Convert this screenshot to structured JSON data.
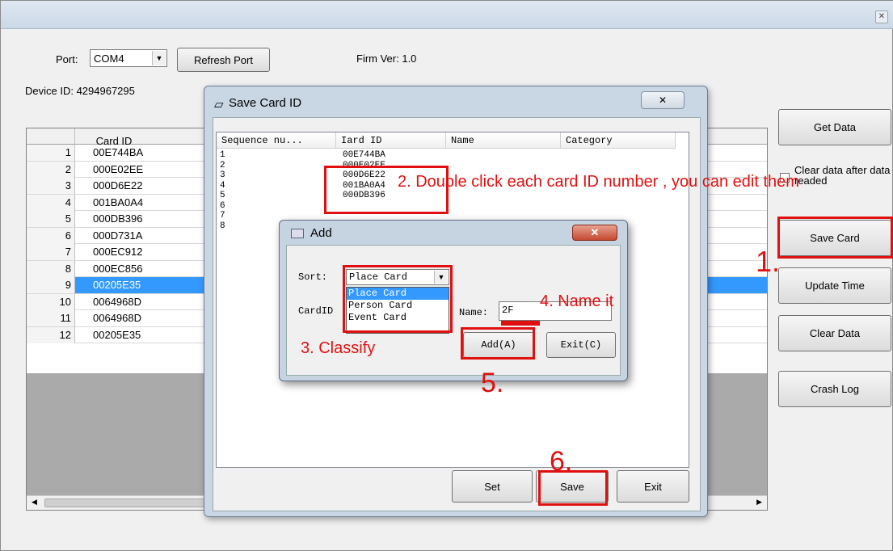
{
  "main": {
    "port_label": "Port:",
    "port_value": "COM4",
    "refresh_port": "Refresh Port",
    "firm_ver": "Firm Ver: 1.0",
    "device_id": "Device ID: 4294967295",
    "grid_header": "Card ID",
    "rows": [
      {
        "n": "1",
        "id": "00E744BA"
      },
      {
        "n": "2",
        "id": "000E02EE"
      },
      {
        "n": "3",
        "id": "000D6E22"
      },
      {
        "n": "4",
        "id": "001BA0A4"
      },
      {
        "n": "5",
        "id": "000DB396"
      },
      {
        "n": "6",
        "id": "000D731A"
      },
      {
        "n": "7",
        "id": "000EC912"
      },
      {
        "n": "8",
        "id": "000EC856"
      },
      {
        "n": "9",
        "id": "00205E35"
      },
      {
        "n": "10",
        "id": "0064968D"
      },
      {
        "n": "11",
        "id": "0064968D"
      },
      {
        "n": "12",
        "id": "00205E35"
      }
    ],
    "selected_row": "9"
  },
  "right_panel": {
    "get_data": "Get Data",
    "clear_after": "Clear data after data readed",
    "save_card": "Save Card",
    "update_time": "Update Time",
    "clear_data": "Clear Data",
    "crash_log": "Crash Log"
  },
  "save_dialog": {
    "title": "Save Card ID",
    "close": "✕",
    "columns": [
      "Sequence nu...",
      "Iard ID",
      "Name",
      "Category"
    ],
    "rows": [
      {
        "seq": "1",
        "id": "00E744BA"
      },
      {
        "seq": "2",
        "id": "000E02EE"
      },
      {
        "seq": "3",
        "id": "000D6E22"
      },
      {
        "seq": "4",
        "id": "001BA0A4"
      },
      {
        "seq": "5",
        "id": "000DB396"
      },
      {
        "seq": "6",
        "id": ""
      },
      {
        "seq": "7",
        "id": ""
      },
      {
        "seq": "8",
        "id": ""
      }
    ],
    "set_button": "Set",
    "save_button": "Save",
    "exit_button": "Exit"
  },
  "add_dialog": {
    "title": "Add",
    "sort_label": "Sort:",
    "sort_value": "Place Card",
    "options": [
      "Place Card",
      "Person Card",
      "Event Card"
    ],
    "cardid_label": "CardID",
    "name_label": "Name:",
    "name_value": "2F",
    "add_button": "Add(A)",
    "exit_button": "Exit(C)"
  },
  "annotations": {
    "step1": "1.",
    "step2": "2. Double click each card ID number , you can edit them",
    "step3": "3. Classify",
    "step4": "4. Name it",
    "step5": "5.",
    "step6": "6."
  },
  "colors": {
    "annotation": "#e01010",
    "selection": "#3399ff"
  }
}
